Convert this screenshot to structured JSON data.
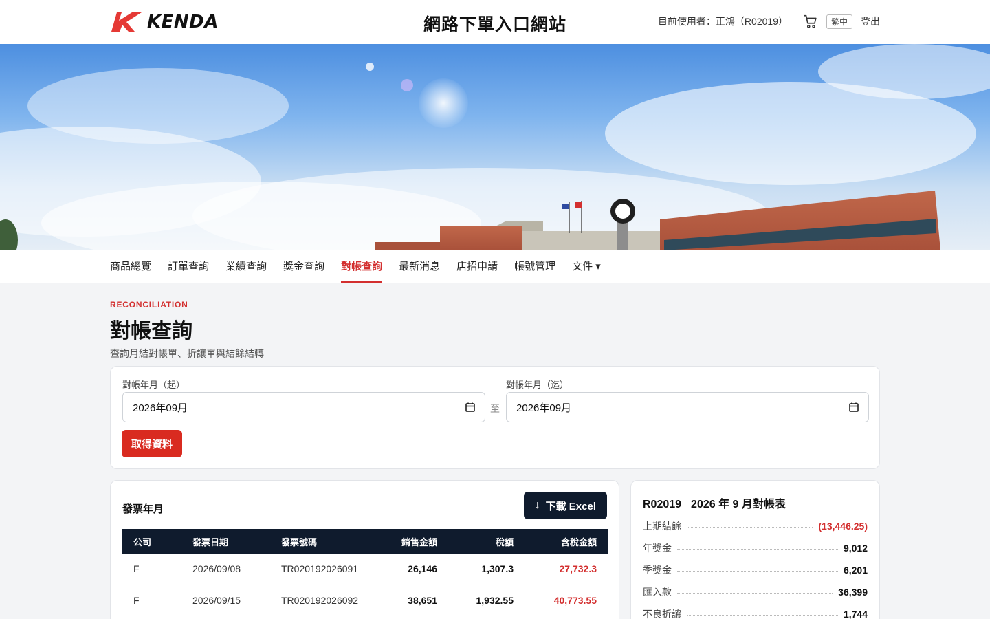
{
  "header": {
    "logo_text": "KENDA",
    "site_title": "網路下單入口網站",
    "user_label": "目前使用者：正鴻（R02019）",
    "lang": "繁中",
    "logout": "登出",
    "brand_color": "#e53935"
  },
  "nav": {
    "items": [
      {
        "label": "商品總覽"
      },
      {
        "label": "訂單查詢"
      },
      {
        "label": "業績查詢"
      },
      {
        "label": "獎金查詢"
      },
      {
        "label": "對帳查詢",
        "active": true
      },
      {
        "label": "最新消息"
      },
      {
        "label": "店招申請"
      },
      {
        "label": "帳號管理"
      },
      {
        "label": "文件 ▾"
      }
    ]
  },
  "page": {
    "eyebrow": "RECONCILIATION",
    "title": "對帳查詢",
    "description": "查詢月結對帳單、折讓單與結餘結轉"
  },
  "filter": {
    "start_label": "對帳年月（起）",
    "start_value": "2026年09月",
    "separator": "至",
    "end_label": "對帳年月（迄）",
    "end_value": "2026年09月",
    "fetch_button": "取得資料"
  },
  "invoice": {
    "title": "發票年月",
    "download_button": "下載 Excel",
    "columns": [
      "公司",
      "發票日期",
      "發票號碼",
      "銷售金額",
      "稅額",
      "含稅金額"
    ],
    "rows": [
      [
        "F",
        "2026/09/08",
        "TR020192026091",
        "26,146",
        "1,307.3",
        "27,732.3"
      ],
      [
        "F",
        "2026/09/15",
        "TR020192026092",
        "38,651",
        "1,932.55",
        "40,773.55"
      ]
    ]
  },
  "summary": {
    "account": "R02019",
    "title": "2026 年 9 月對帳表",
    "rows": [
      {
        "label": "上期結餘",
        "value": "(13,446.25)",
        "negative": true
      },
      {
        "label": "年獎金",
        "value": "9,012"
      },
      {
        "label": "季獎金",
        "value": "6,201"
      },
      {
        "label": "匯入款",
        "value": "36,399"
      },
      {
        "label": "不良折讓",
        "value": "1,744"
      }
    ]
  },
  "icons": {
    "cart": "cart-icon",
    "calendar": "calendar-icon",
    "download": "download-arrow-icon"
  }
}
